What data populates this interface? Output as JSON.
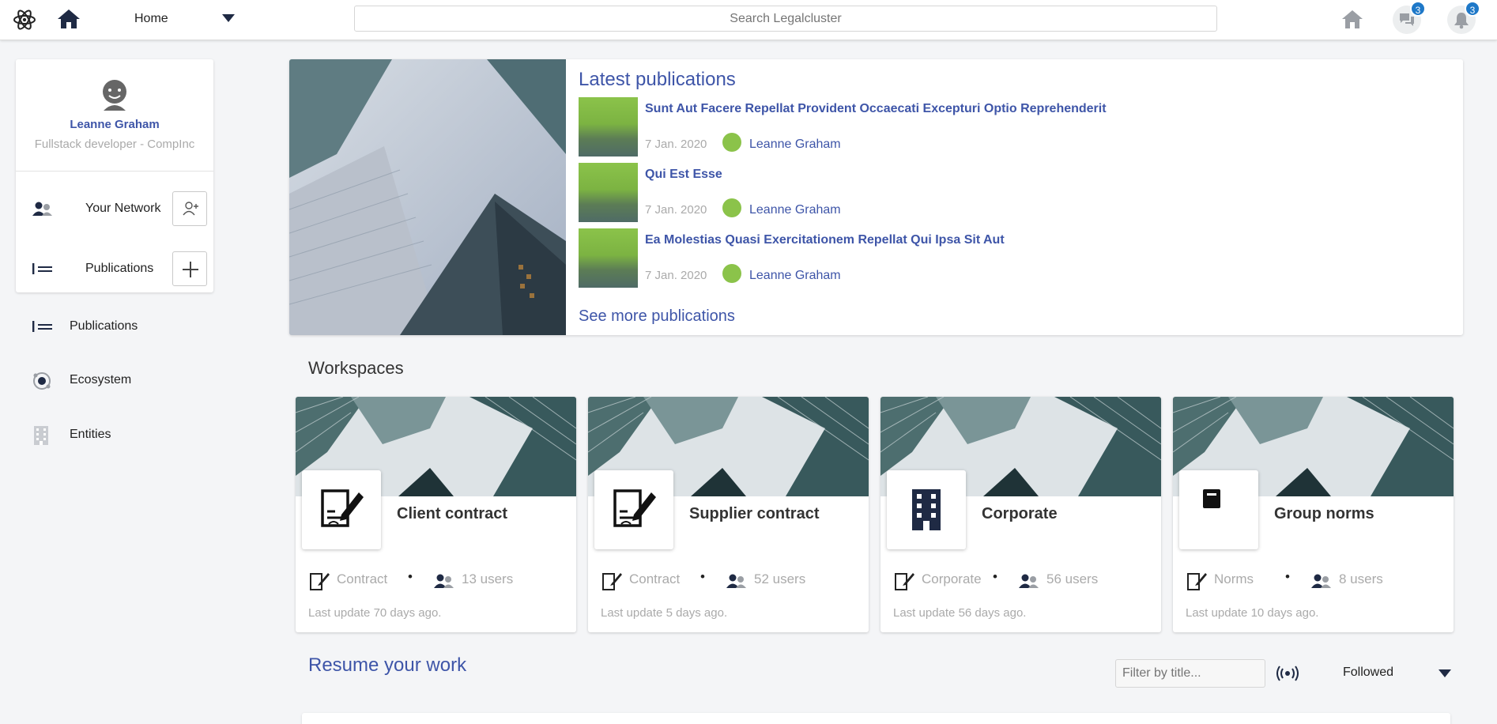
{
  "topbar": {
    "nav_selected": "Home",
    "search_placeholder": "Search Legalcluster",
    "messages_badge": "3",
    "notifications_badge": "3"
  },
  "profile": {
    "name": "Leanne Graham",
    "role": "Fullstack developer - CompInc",
    "rows": [
      {
        "label": "Your Network",
        "icon": "people-icon",
        "action_icon": "add-user-icon"
      },
      {
        "label": "Publications",
        "icon": "list-icon",
        "action_icon": "plus-icon"
      }
    ]
  },
  "sidebar": {
    "items": [
      {
        "label": "Publications",
        "icon": "list-icon"
      },
      {
        "label": "Ecosystem",
        "icon": "ecosystem-icon"
      },
      {
        "label": "Entities",
        "icon": "building-icon"
      }
    ]
  },
  "latest": {
    "title": "Latest publications",
    "items": [
      {
        "title": "Sunt Aut Facere Repellat Provident Occaecati Excepturi Optio Reprehenderit",
        "date": "7 Jan. 2020",
        "author": "Leanne Graham"
      },
      {
        "title": "Qui Est Esse",
        "date": "7 Jan. 2020",
        "author": "Leanne Graham"
      },
      {
        "title": "Ea Molestias Quasi Exercitationem Repellat Qui Ipsa Sit Aut",
        "date": "7 Jan. 2020",
        "author": "Leanne Graham"
      }
    ],
    "see_more": "See more publications"
  },
  "workspaces": {
    "title": "Workspaces",
    "cards": [
      {
        "name": "Client contract",
        "category": "Contract",
        "users": "13 users",
        "updated": "Last update 70 days ago.",
        "icon": "contract-icon"
      },
      {
        "name": "Supplier contract",
        "category": "Contract",
        "users": "52 users",
        "updated": "Last update 5 days ago.",
        "icon": "contract-icon"
      },
      {
        "name": "Corporate",
        "category": "Corporate",
        "users": "56 users",
        "updated": "Last update 56 days ago.",
        "icon": "building-icon"
      },
      {
        "name": "Group norms",
        "category": "Norms",
        "users": "8 users",
        "updated": "Last update 10 days ago.",
        "icon": "book-icon"
      }
    ],
    "separator": "•"
  },
  "resume": {
    "title": "Resume your work",
    "filter_placeholder": "Filter by title...",
    "dropdown_value": "Followed"
  },
  "colors": {
    "accent": "#3e55a8",
    "badge": "#1e78c8",
    "pub_green": "#8bc34a",
    "background": "#f4f5f7"
  }
}
